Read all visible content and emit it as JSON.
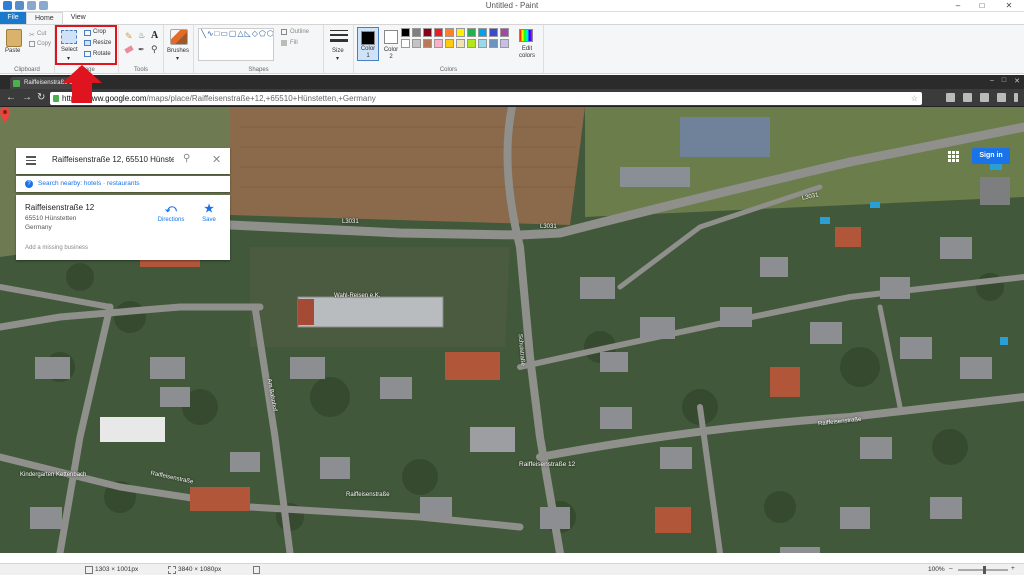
{
  "paint": {
    "window_title": "Untitled - Paint",
    "tabs": [
      "File",
      "Home",
      "View"
    ],
    "clipboard": {
      "paste": "Paste",
      "cut": "Cut",
      "copy": "Copy",
      "group": "Clipboard"
    },
    "image": {
      "select": "Select",
      "crop": "Crop",
      "resize": "Resize",
      "rotate": "Rotate",
      "group": "Image"
    },
    "tools": {
      "group": "Tools"
    },
    "brushes": {
      "label": "Brushes"
    },
    "shapes": {
      "outline": "Outline",
      "fill": "Fill",
      "group": "Shapes"
    },
    "size": {
      "label": "Size"
    },
    "colors": {
      "color1": "Color 1",
      "color2": "Color 2",
      "edit": "Edit colors",
      "group": "Colors",
      "palette": [
        "#000000",
        "#7f7f7f",
        "#880015",
        "#ed1c24",
        "#ff7f27",
        "#fff200",
        "#22b14c",
        "#00a2e8",
        "#3f48cc",
        "#a349a4",
        "#ffffff",
        "#c3c3c3",
        "#b97a57",
        "#ffaec9",
        "#ffc90e",
        "#efe4b0",
        "#b5e61d",
        "#99d9ea",
        "#7092be",
        "#c8bfe7"
      ]
    },
    "status": {
      "cursor": "1303 × 1001px",
      "canvas_size": "3840 × 1080px",
      "zoom": "100%"
    }
  },
  "browser": {
    "tab_title": "Raiffeisenstraße 12",
    "url_host": "https://www.google.com",
    "url_path": "/maps/place/Raiffeisenstraße+12,+65510+Hünstetten,+Germany"
  },
  "maps": {
    "search_value": "Raiffeisenstraße 12, 65510 Hünste",
    "nearby": "Search nearby: hotels · restaurants",
    "place": {
      "name": "Raiffeisenstraße 12",
      "line1": "65510 Hünstetten",
      "line2": "Germany",
      "add_business": "Add a missing business"
    },
    "directions": "Directions",
    "save": "Save",
    "signin": "Sign in",
    "pin_label": "Raiffeisenstraße 12",
    "labels": {
      "road_l3031_a": "L3031",
      "road_l3031_b": "L3031",
      "road_l3031_c": "L3031",
      "wahl": "Wahl-Reisen e.K.",
      "kindergarten": "Kindergarten Kettenbach",
      "raiff_1": "Raiffeisenstraße",
      "raiff_2": "Raiffeisenstraße",
      "raiff_3": "Raiffeisenstraße",
      "bahnhof": "Am Bahnhof",
      "schulstr": "Schulstraße"
    }
  }
}
